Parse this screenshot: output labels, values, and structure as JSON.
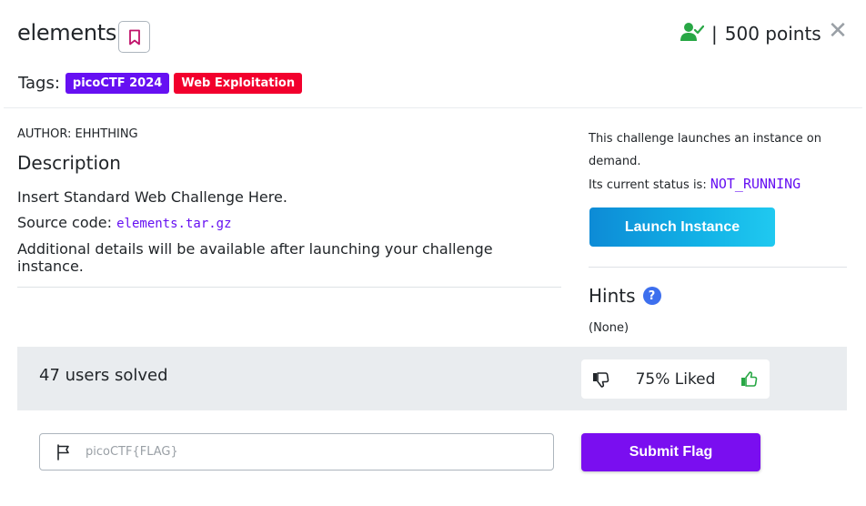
{
  "challenge": {
    "title": "elements",
    "points_separator": "|",
    "points": "500 points",
    "close_symbol": "✕"
  },
  "tags": {
    "label": "Tags:",
    "items": [
      {
        "label": "picoCTF 2024",
        "color": "#6610f2"
      },
      {
        "label": "Web Exploitation",
        "color": "#f2002d"
      }
    ]
  },
  "description": {
    "author": "AUTHOR: EHHTHING",
    "heading": "Description",
    "line1": "Insert Standard Web Challenge Here.",
    "source_label": "Source code: ",
    "source_file": "elements.tar.gz",
    "line3": "Additional details will be available after launching your challenge instance."
  },
  "instance": {
    "info": "This challenge launches an instance on demand.",
    "status_label": "Its current status is: ",
    "status_value": "NOT_RUNNING",
    "launch_label": "Launch Instance"
  },
  "hints": {
    "title": "Hints",
    "help_symbol": "?",
    "value": "(None)"
  },
  "stats": {
    "solved": "47 users solved",
    "liked": "75% Liked"
  },
  "flag": {
    "placeholder": "picoCTF{FLAG}",
    "submit_label": "Submit Flag"
  },
  "icons": {
    "bookmark": "bookmark-icon",
    "user_check": "user-check-icon",
    "close": "close-icon",
    "help": "help-icon",
    "thumbs_down": "thumbs-down-icon",
    "thumbs_up": "thumbs-up-icon",
    "flag": "flag-icon"
  },
  "colors": {
    "accent_purple": "#6610f2",
    "submit_purple": "#7a0ef0",
    "launch_cyan": "#12b2e6",
    "success_green": "#28a745",
    "help_blue": "#3d6fee"
  }
}
